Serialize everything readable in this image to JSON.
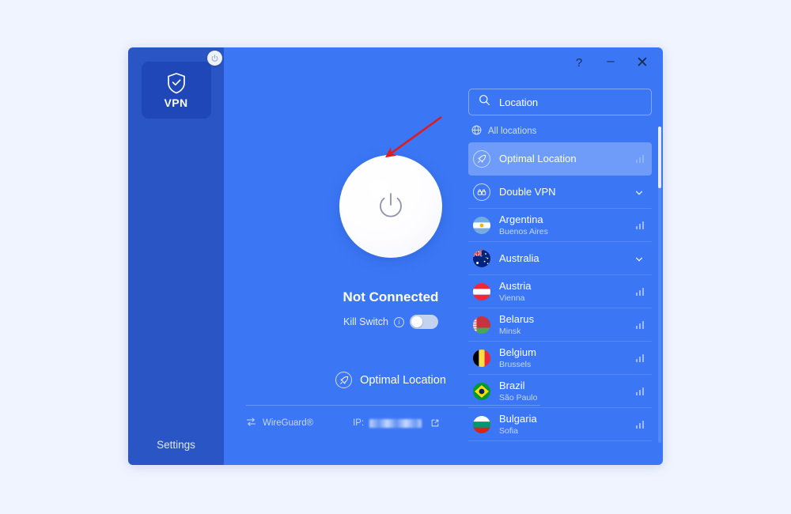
{
  "window": {
    "controls": [
      {
        "name": "help-button",
        "glyph": "?"
      },
      {
        "name": "minimize-button",
        "glyph": "–"
      },
      {
        "name": "close-button",
        "glyph": "✕"
      }
    ],
    "help_glyph": "?",
    "minimize_glyph": "–",
    "close_glyph": "✕"
  },
  "sidebar": {
    "app_tile_label": "VPN",
    "settings_label": "Settings",
    "power_badge_icon": "power-icon",
    "shield_icon": "shield-check-icon"
  },
  "connection": {
    "power_button_icon": "power-icon",
    "status": "Not Connected",
    "kill_switch_label": "Kill Switch",
    "kill_switch_info_glyph": "i",
    "kill_switch_enabled": false,
    "selected_location_label": "Optimal Location",
    "selected_location_icon": "rocket-icon",
    "protocol_label": "WireGuard®",
    "protocol_icon": "swap-arrows-icon",
    "ip_label": "IP:",
    "ip_value": "",
    "ip_redacted": true,
    "external_link_icon": "external-link-icon"
  },
  "locations": {
    "search_placeholder": "Location",
    "search_value": "",
    "search_icon": "search-icon",
    "group_header": "All locations",
    "group_header_icon": "globe-icon",
    "items": [
      {
        "name": "Optimal Location",
        "city": "",
        "icon": "rocket-icon",
        "type": "optimal",
        "selected": true,
        "trailing": "signal-bars-icon"
      },
      {
        "name": "Double VPN",
        "city": "",
        "icon": "double-vpn-icon",
        "type": "group",
        "selected": false,
        "trailing": "chevron-down-icon"
      },
      {
        "name": "Argentina",
        "city": "Buenos Aires",
        "icon": "flag-argentina",
        "type": "country",
        "selected": false,
        "trailing": "signal-bars-icon"
      },
      {
        "name": "Australia",
        "city": "",
        "icon": "flag-australia",
        "type": "country-group",
        "selected": false,
        "trailing": "chevron-down-icon"
      },
      {
        "name": "Austria",
        "city": "Vienna",
        "icon": "flag-austria",
        "type": "country",
        "selected": false,
        "trailing": "signal-bars-icon"
      },
      {
        "name": "Belarus",
        "city": "Minsk",
        "icon": "flag-belarus",
        "type": "country",
        "selected": false,
        "trailing": "signal-bars-icon"
      },
      {
        "name": "Belgium",
        "city": "Brussels",
        "icon": "flag-belgium",
        "type": "country",
        "selected": false,
        "trailing": "signal-bars-icon"
      },
      {
        "name": "Brazil",
        "city": "São Paulo",
        "icon": "flag-brazil",
        "type": "country",
        "selected": false,
        "trailing": "signal-bars-icon"
      },
      {
        "name": "Bulgaria",
        "city": "Sofia",
        "icon": "flag-bulgaria",
        "type": "country",
        "selected": false,
        "trailing": "signal-bars-icon"
      }
    ]
  },
  "annotation": {
    "type": "arrow",
    "color": "#e01b1b",
    "points_to": "power-connect-button"
  },
  "colors": {
    "page_background": "#f0f4fe",
    "sidebar": "#2a55c4",
    "sidebar_tile": "#1f47b8",
    "main_background": "#3b77f5",
    "selected_row": "#6f9bf9",
    "accent_white": "#ffffff",
    "annotation_red": "#e01b1b"
  }
}
